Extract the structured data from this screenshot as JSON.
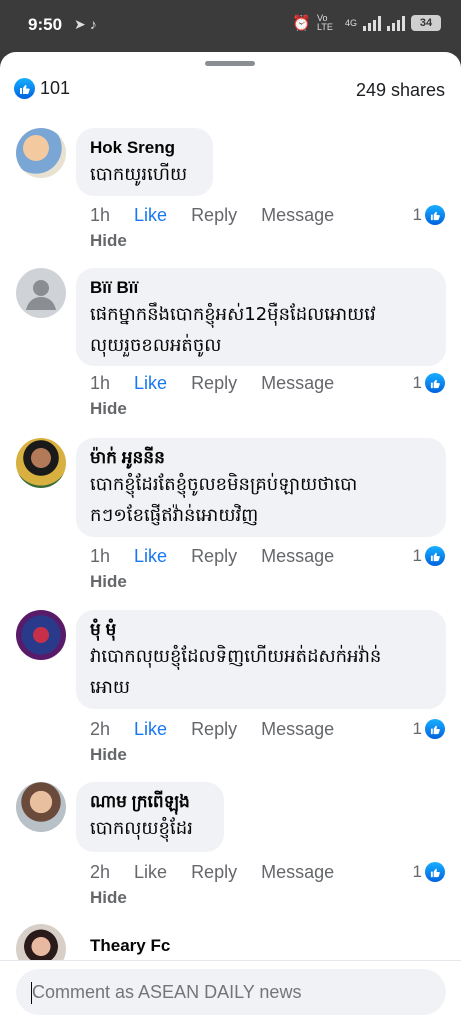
{
  "status": {
    "time": "9:50",
    "battery": "34",
    "volte": "Vo LTE",
    "net": "4G"
  },
  "reactions": {
    "count": "101",
    "shares": "249 shares"
  },
  "actions": {
    "like": "Like",
    "reply": "Reply",
    "message": "Message",
    "hide": "Hide"
  },
  "comments": [
    {
      "author": "Hok Sreng",
      "lines": [
        "បោកយូរហើយ"
      ],
      "time": "1h",
      "reacts": "1",
      "liked": true
    },
    {
      "author": "Bïï Bïï",
      "lines": [
        "ផេកម្នាកនឹងបោកខ្ញុំអស់12ម៉ឺនដែលអោយវេ",
        "លុយរួចខលអត់ចូល"
      ],
      "time": "1h",
      "reacts": "1",
      "liked": true
    },
    {
      "author": "ម៉ាក់ អូននីន",
      "lines": [
        "បោកខ្ញុំដែរតែខ្ញុំចូលខមិនគ្រប់ឡាយថាបោ",
        "កៗ១ខែផ្ញើឥវ៉ាន់អោយវិញ"
      ],
      "time": "1h",
      "reacts": "1",
      "liked": true
    },
    {
      "author": "មុំ មុំ",
      "lines": [
        "វាបោកលុយខ្ញុំដែលទិញហើយអត់ដសក់អវ៉ាន់",
        "អោយ"
      ],
      "time": "2h",
      "reacts": "1",
      "liked": true
    },
    {
      "author": "ណាម ក្រពើឡុង",
      "lines": [
        "បោកលុយខ្ញុំដែរ"
      ],
      "time": "2h",
      "reacts": "1",
      "liked": false
    },
    {
      "author": "Theary Fc",
      "lines": [],
      "time": "",
      "reacts": "",
      "liked": false
    }
  ],
  "composer": {
    "placeholder": "Comment as ASEAN DAILY news"
  },
  "colors": {
    "accent": "#1877f2",
    "bubble": "#f0f2f5",
    "muted": "#65676b"
  }
}
